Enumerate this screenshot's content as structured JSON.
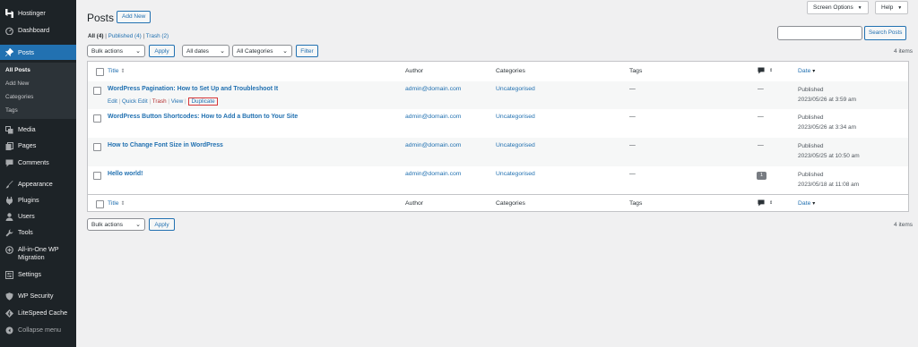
{
  "sidebar": {
    "brand": "Hostinger",
    "items": [
      {
        "label": "Dashboard",
        "icon": "dashboard-icon"
      },
      {
        "label": "Posts",
        "icon": "pin-icon"
      },
      {
        "label": "Media",
        "icon": "media-icon"
      },
      {
        "label": "Pages",
        "icon": "pages-icon"
      },
      {
        "label": "Comments",
        "icon": "comments-icon"
      },
      {
        "label": "Appearance",
        "icon": "brush-icon"
      },
      {
        "label": "Plugins",
        "icon": "plugin-icon"
      },
      {
        "label": "Users",
        "icon": "users-icon"
      },
      {
        "label": "Tools",
        "icon": "wrench-icon"
      },
      {
        "label": "All-in-One WP Migration",
        "icon": "migration-icon"
      },
      {
        "label": "Settings",
        "icon": "settings-icon"
      },
      {
        "label": "WP Security",
        "icon": "shield-icon"
      },
      {
        "label": "LiteSpeed Cache",
        "icon": "litespeed-icon"
      },
      {
        "label": "Collapse menu",
        "icon": "collapse-icon"
      }
    ],
    "submenu": [
      "All Posts",
      "Add New",
      "Categories",
      "Tags"
    ]
  },
  "header": {
    "title": "Posts",
    "add_new": "Add New",
    "screen_options": "Screen Options",
    "help": "Help"
  },
  "filters": {
    "all": "All (4)",
    "published": "Published (4)",
    "trash": "Trash (2)",
    "sep": "|"
  },
  "search": {
    "button": "Search Posts",
    "value": ""
  },
  "toolbar": {
    "bulk_actions": "Bulk actions",
    "apply": "Apply",
    "all_dates": "All dates",
    "all_categories": "All Categories",
    "filter": "Filter",
    "items_count": "4 items"
  },
  "table": {
    "columns": {
      "title": "Title",
      "author": "Author",
      "categories": "Categories",
      "tags": "Tags",
      "date": "Date"
    },
    "row_actions": {
      "edit": "Edit",
      "quick_edit": "Quick Edit",
      "trash": "Trash",
      "view": "View",
      "duplicate": "Duplicate",
      "sep": "|"
    },
    "rows": [
      {
        "title": "WordPress Pagination: How to Set Up and Troubleshoot It",
        "author": "admin@domain.com",
        "category": "Uncategorised",
        "tags": "—",
        "comments": "—",
        "status": "Published",
        "date": "2023/05/26 at 3:59 am"
      },
      {
        "title": "WordPress Button Shortcodes: How to Add a Button to Your Site",
        "author": "admin@domain.com",
        "category": "Uncategorised",
        "tags": "—",
        "comments": "—",
        "status": "Published",
        "date": "2023/05/26 at 3:34 am"
      },
      {
        "title": "How to Change Font Size in WordPress",
        "author": "admin@domain.com",
        "category": "Uncategorised",
        "tags": "—",
        "comments": "—",
        "status": "Published",
        "date": "2023/05/25 at 10:50 am"
      },
      {
        "title": "Hello world!",
        "author": "admin@domain.com",
        "category": "Uncategorised",
        "tags": "—",
        "comments": "1",
        "status": "Published",
        "date": "2023/05/18 at 11:08 am"
      }
    ]
  },
  "colors": {
    "accent": "#2271b1",
    "sidebar": "#1d2327",
    "highlight": "#d63638"
  }
}
